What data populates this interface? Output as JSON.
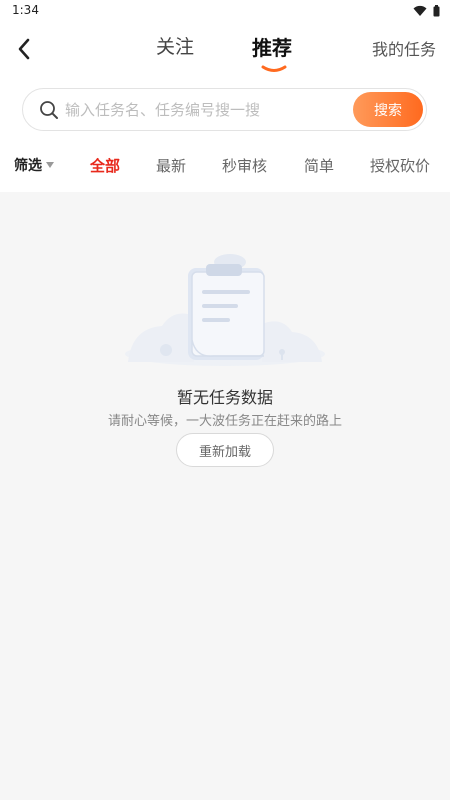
{
  "status_bar": {
    "time": "1:34",
    "icons": [
      "wifi-icon",
      "battery-icon"
    ]
  },
  "navbar": {
    "back_icon": "chevron-left-icon",
    "tabs": [
      {
        "label": "关注",
        "active": false
      },
      {
        "label": "推荐",
        "active": true
      }
    ],
    "my_tasks": "我的任务"
  },
  "search": {
    "placeholder": "输入任务名、任务编号搜一搜",
    "value": "",
    "button": "搜索",
    "icon": "search-icon"
  },
  "filters": {
    "label": "筛选",
    "label_icon": "triangle-down-icon",
    "items": [
      {
        "label": "全部",
        "active": true
      },
      {
        "label": "最新",
        "active": false
      },
      {
        "label": "秒审核",
        "active": false
      },
      {
        "label": "简单",
        "active": false
      },
      {
        "label": "授权砍价",
        "active": false
      }
    ]
  },
  "empty_state": {
    "illustration": "empty-clipboard-icon",
    "title": "暂无任务数据",
    "subtitle": "请耐心等候，一大波任务正在赶来的路上",
    "reload": "重新加载"
  },
  "colors": {
    "accent": "#ff6a1f",
    "active_filter": "#e8291c",
    "background": "#f6f6f6"
  }
}
